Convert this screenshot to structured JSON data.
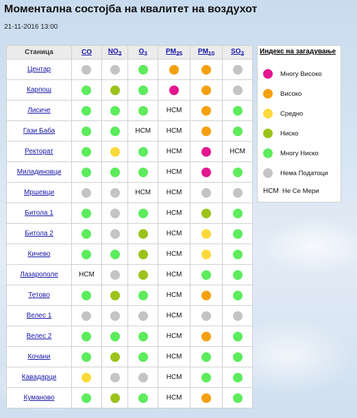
{
  "title": "Моментална состојба на квалитет на воздухот",
  "timestamp": "21-11-2016 13:00",
  "colors": {
    "very_high": "#e3178e",
    "high": "#f5a00f",
    "medium": "#fcd93a",
    "low": "#9bc31b",
    "very_low": "#5cec5c",
    "no_data": "#c4c4c4"
  },
  "table": {
    "station_header": "Станица",
    "columns": [
      {
        "key": "co",
        "main": "CO",
        "sub": ""
      },
      {
        "key": "no2",
        "main": "NO",
        "sub": "2"
      },
      {
        "key": "o3",
        "main": "O",
        "sub": "3"
      },
      {
        "key": "pm25",
        "main": "PM",
        "sub": "25"
      },
      {
        "key": "pm10",
        "main": "PM",
        "sub": "10"
      },
      {
        "key": "so2",
        "main": "SO",
        "sub": "2"
      }
    ],
    "nsm_text": "НСМ",
    "rows": [
      {
        "station": "Центар",
        "values": [
          "no_data",
          "no_data",
          "very_low",
          "high",
          "high",
          "no_data"
        ]
      },
      {
        "station": "Карпош",
        "values": [
          "very_low",
          "low",
          "very_low",
          "very_high",
          "high",
          "no_data"
        ]
      },
      {
        "station": "Лисиче",
        "values": [
          "very_low",
          "very_low",
          "very_low",
          "nsm",
          "high",
          "very_low"
        ]
      },
      {
        "station": "Гази Баба",
        "values": [
          "very_low",
          "very_low",
          "nsm",
          "nsm",
          "high",
          "very_low"
        ]
      },
      {
        "station": "Ректорат",
        "values": [
          "very_low",
          "medium",
          "very_low",
          "nsm",
          "very_high",
          "nsm"
        ]
      },
      {
        "station": "Миладиновци",
        "values": [
          "very_low",
          "very_low",
          "very_low",
          "nsm",
          "very_high",
          "very_low"
        ]
      },
      {
        "station": "Мршевци",
        "values": [
          "no_data",
          "no_data",
          "nsm",
          "nsm",
          "no_data",
          "no_data"
        ]
      },
      {
        "station": "Битола 1",
        "values": [
          "very_low",
          "no_data",
          "very_low",
          "nsm",
          "low",
          "very_low"
        ]
      },
      {
        "station": "Битола 2",
        "values": [
          "very_low",
          "no_data",
          "low",
          "nsm",
          "medium",
          "very_low"
        ]
      },
      {
        "station": "Кичево",
        "values": [
          "very_low",
          "very_low",
          "low",
          "nsm",
          "medium",
          "very_low"
        ]
      },
      {
        "station": "Лазарополе",
        "values": [
          "nsm",
          "no_data",
          "low",
          "nsm",
          "very_low",
          "very_low"
        ]
      },
      {
        "station": "Тетово",
        "values": [
          "very_low",
          "low",
          "very_low",
          "nsm",
          "high",
          "very_low"
        ]
      },
      {
        "station": "Велес 1",
        "values": [
          "no_data",
          "no_data",
          "no_data",
          "nsm",
          "no_data",
          "no_data"
        ]
      },
      {
        "station": "Велес 2",
        "values": [
          "very_low",
          "very_low",
          "very_low",
          "nsm",
          "high",
          "very_low"
        ]
      },
      {
        "station": "Кочани",
        "values": [
          "very_low",
          "low",
          "very_low",
          "nsm",
          "very_low",
          "very_low"
        ]
      },
      {
        "station": "Кавадарци",
        "values": [
          "medium",
          "no_data",
          "no_data",
          "nsm",
          "very_low",
          "very_low"
        ]
      },
      {
        "station": "Куманово",
        "values": [
          "very_low",
          "low",
          "very_low",
          "nsm",
          "high",
          "very_low"
        ]
      }
    ]
  },
  "legend": {
    "title": "Индекс на загадување",
    "items": [
      {
        "level": "very_high",
        "label": "Многу Високо"
      },
      {
        "level": "high",
        "label": "Високо"
      },
      {
        "level": "medium",
        "label": "Средно"
      },
      {
        "level": "low",
        "label": "Ниско"
      },
      {
        "level": "very_low",
        "label": "Многу Ниско"
      },
      {
        "level": "no_data",
        "label": "Нема Податоци"
      },
      {
        "level": "nsm",
        "label": "Не Се Мери",
        "swatch": "НСМ"
      }
    ]
  }
}
